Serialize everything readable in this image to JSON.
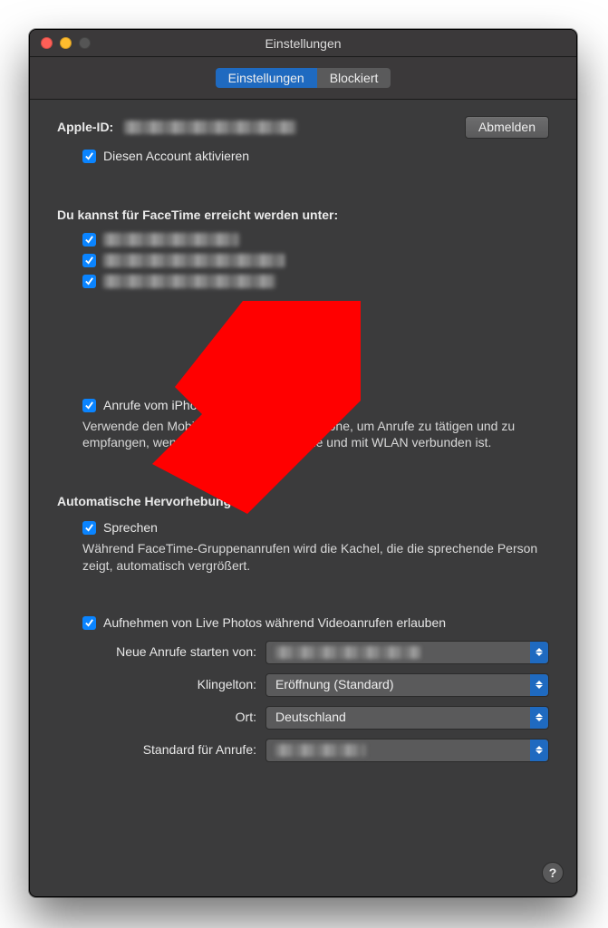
{
  "window": {
    "title": "Einstellungen"
  },
  "tabs": {
    "active": "Einstellungen",
    "inactive": "Blockiert"
  },
  "apple_id": {
    "label": "Apple-ID:",
    "sign_out": "Abmelden",
    "activate": "Diesen Account aktivieren"
  },
  "reachable": {
    "heading": "Du kannst für FaceTime erreicht werden unter:"
  },
  "iphone_calls": {
    "label": "Anrufe vom iPhone",
    "desc": "Verwende den Mobilfunkaccount deines iPhone, um Anrufe zu tätigen und zu empfangen, wenn dein iPhone in der Nähe und mit WLAN verbunden ist."
  },
  "auto_highlight": {
    "heading": "Automatische Hervorhebung",
    "speak": "Sprechen",
    "desc": "Während FaceTime-Gruppenanrufen wird die Kachel, die die sprechende Person zeigt, automatisch vergrößert."
  },
  "live_photos": {
    "label": "Aufnehmen von Live Photos während Videoanrufen erlauben"
  },
  "popups": {
    "new_calls_label": "Neue Anrufe starten von:",
    "ringtone_label": "Klingelton:",
    "ringtone_value": "Eröffnung (Standard)",
    "location_label": "Ort:",
    "location_value": "Deutschland",
    "default_calls_label": "Standard für Anrufe:"
  },
  "help": {
    "glyph": "?"
  }
}
